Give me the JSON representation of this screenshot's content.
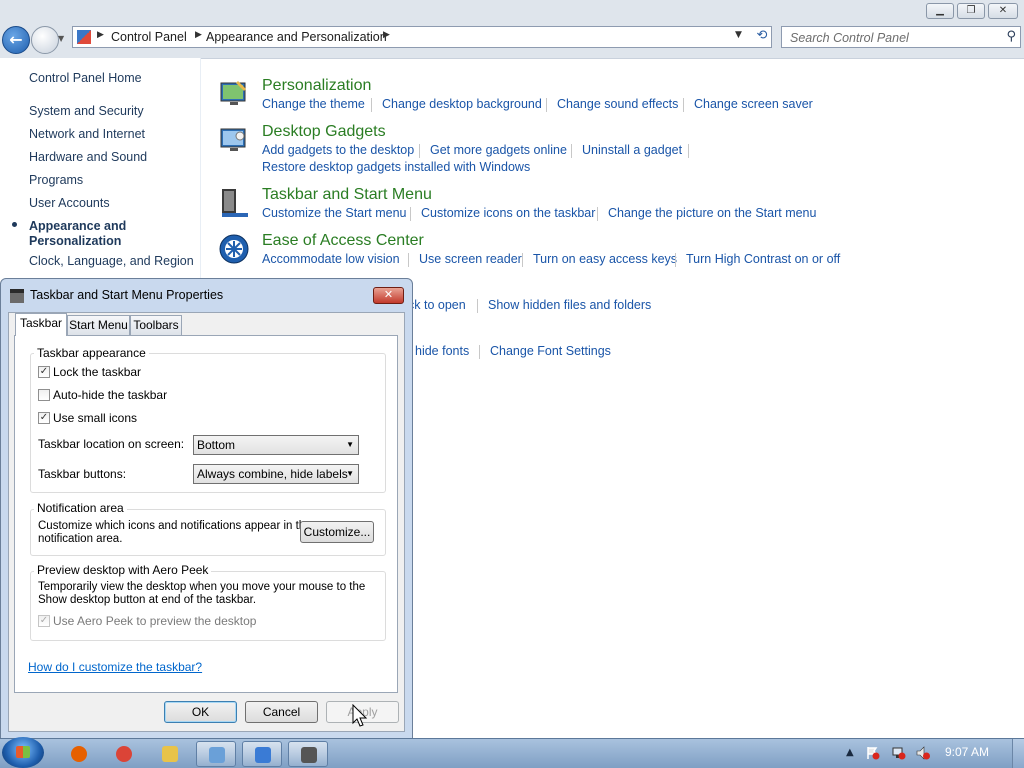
{
  "window": {
    "address": {
      "crumbs": [
        "Control Panel",
        "Appearance and Personalization"
      ]
    },
    "search_placeholder": "Search Control Panel"
  },
  "sidebar": {
    "home": "Control Panel Home",
    "items": [
      {
        "label": "System and Security"
      },
      {
        "label": "Network and Internet"
      },
      {
        "label": "Hardware and Sound"
      },
      {
        "label": "Programs"
      },
      {
        "label": "User Accounts"
      },
      {
        "label_line1": "Appearance and",
        "label_line2": "Personalization",
        "selected": true
      },
      {
        "label": "Clock, Language, and Region"
      }
    ]
  },
  "categories": [
    {
      "title": "Personalization",
      "links": [
        "Change the theme",
        "Change desktop background",
        "Change sound effects",
        "Change screen saver"
      ]
    },
    {
      "title": "Desktop Gadgets",
      "links": [
        "Add gadgets to the desktop",
        "Get more gadgets online",
        "Uninstall a gadget",
        "Restore desktop gadgets installed with Windows"
      ]
    },
    {
      "title": "Taskbar and Start Menu",
      "links": [
        "Customize the Start menu",
        "Customize icons on the taskbar",
        "Change the picture on the Start menu"
      ]
    },
    {
      "title": "Ease of Access Center",
      "links": [
        "Accommodate low vision",
        "Use screen reader",
        "Turn on easy access keys",
        "Turn High Contrast on or off"
      ]
    },
    {
      "partial_links": [
        "ck to open",
        "Show hidden files and folders"
      ]
    },
    {
      "partial_links": [
        "hide fonts",
        "Change Font Settings"
      ]
    }
  ],
  "dialog": {
    "title": "Taskbar and Start Menu Properties",
    "tabs": [
      "Taskbar",
      "Start Menu",
      "Toolbars"
    ],
    "active_tab": "Taskbar",
    "appearance": {
      "heading": "Taskbar appearance",
      "lock": {
        "label": "Lock the taskbar",
        "checked": true
      },
      "autohide": {
        "label": "Auto-hide the taskbar",
        "checked": false
      },
      "small_icons": {
        "label": "Use small icons",
        "checked": true
      },
      "location_label": "Taskbar location on screen:",
      "location_value": "Bottom",
      "buttons_label": "Taskbar buttons:",
      "buttons_value": "Always combine, hide labels"
    },
    "notification": {
      "heading": "Notification area",
      "text_line1": "Customize which icons and notifications appear in the",
      "text_line2": "notification area.",
      "button": "Customize..."
    },
    "peek": {
      "heading": "Preview desktop with Aero Peek",
      "text_line1": "Temporarily view the desktop when you move your mouse to the",
      "text_line2": "Show desktop button at end of the taskbar.",
      "checkbox": {
        "label": "Use Aero Peek to preview the desktop",
        "checked": true,
        "disabled": true
      }
    },
    "help_link": "How do I customize the taskbar?",
    "buttons": {
      "ok": "OK",
      "cancel": "Cancel",
      "apply": "Apply"
    }
  },
  "taskbar": {
    "apps": [
      {
        "icon": "firefox-icon",
        "color": "#e66000"
      },
      {
        "icon": "chrome-icon",
        "color": "#db4437"
      },
      {
        "icon": "file-explorer-icon",
        "color": "#e8c34a"
      },
      {
        "icon": "control-panel-icon",
        "color": "#6aa0d8"
      },
      {
        "icon": "remote-desktop-icon",
        "color": "#3a7bd5"
      },
      {
        "icon": "taskbar-properties-icon",
        "color": "#555555"
      }
    ],
    "clock": "9:07 AM"
  },
  "colors": {
    "category_title": "#2a7d23",
    "link": "#1a55a8",
    "sidebar_text": "#1e395b"
  }
}
